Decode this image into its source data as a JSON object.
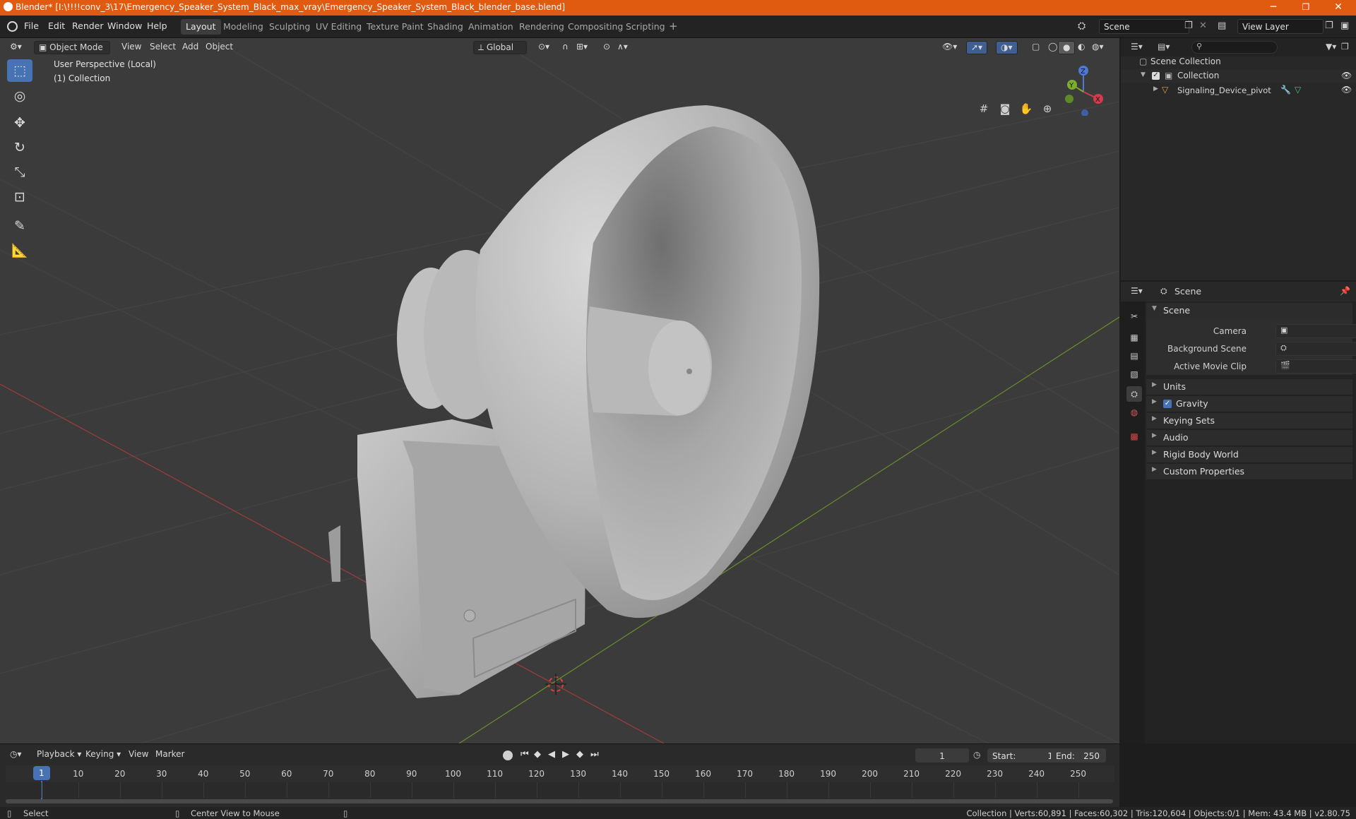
{
  "colors": {
    "accent": "#4772b3",
    "titlebar": "#e05b10",
    "viewport_bg": "#3b3b3b"
  },
  "window": {
    "title": "Blender* [I:\\!!!!conv_3\\17\\Emergency_Speaker_System_Black_max_vray\\Emergency_Speaker_System_Black_blender_base.blend]",
    "minimize": "─",
    "maximize": "❐",
    "close": "✕"
  },
  "menu": {
    "file": "File",
    "edit": "Edit",
    "render": "Render",
    "window": "Window",
    "help": "Help"
  },
  "workspaces": [
    "Layout",
    "Modeling",
    "Sculpting",
    "UV Editing",
    "Texture Paint",
    "Shading",
    "Animation",
    "Rendering",
    "Compositing",
    "Scripting"
  ],
  "workspace_add": "+",
  "scene_selector": {
    "value": "Scene"
  },
  "view_layer_selector": {
    "value": "View Layer"
  },
  "viewport_header": {
    "mode": "Object Mode",
    "view": "View",
    "select": "Select",
    "add": "Add",
    "object": "Object",
    "orientation": "Global"
  },
  "viewport_overlay": {
    "perspective": "User Perspective (Local)",
    "collection": "(1) Collection"
  },
  "gizmo": {
    "z": "Z",
    "y": "Y",
    "x": "X"
  },
  "outliner": {
    "root": "Scene Collection",
    "collection": "Collection",
    "object": "Signaling_Device_pivot"
  },
  "properties": {
    "tab_title": "Scene",
    "panel_scene": "Scene",
    "camera_label": "Camera",
    "background_scene_label": "Background Scene",
    "active_movie_clip_label": "Active Movie Clip",
    "units": "Units",
    "gravity": "Gravity",
    "keying_sets": "Keying Sets",
    "audio": "Audio",
    "rigid_body_world": "Rigid Body World",
    "custom_properties": "Custom Properties"
  },
  "timeline": {
    "playback": "Playback",
    "keying": "Keying",
    "view": "View",
    "marker": "Marker",
    "current_frame": "1",
    "start_label": "Start:",
    "start": "1",
    "end_label": "End:",
    "end": "250",
    "ticks": [
      "1",
      "10",
      "20",
      "30",
      "40",
      "50",
      "60",
      "70",
      "80",
      "90",
      "100",
      "110",
      "120",
      "130",
      "140",
      "150",
      "160",
      "170",
      "180",
      "190",
      "200",
      "210",
      "220",
      "230",
      "240",
      "250"
    ]
  },
  "statusbar": {
    "select": "Select",
    "center_view": "Center View to Mouse",
    "stats": "Collection | Verts:60,891 | Faces:60,302 | Tris:120,604 | Objects:0/1 | Mem: 43.4 MB | v2.80.75"
  }
}
